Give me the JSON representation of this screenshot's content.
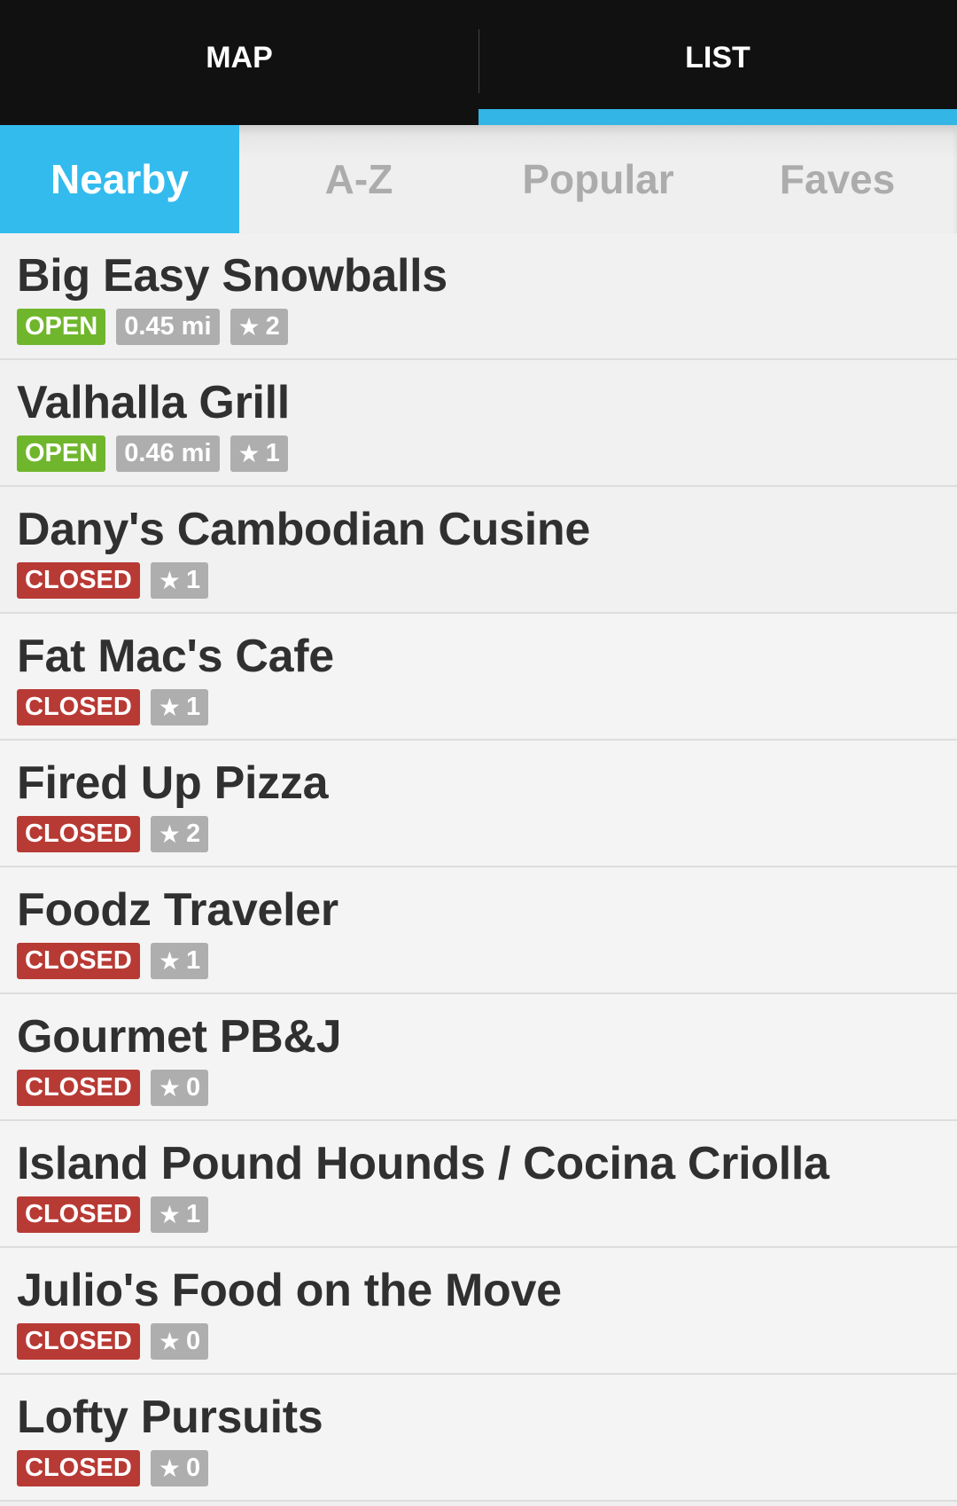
{
  "top_tabs": [
    {
      "label": "MAP",
      "active": false
    },
    {
      "label": "LIST",
      "active": true
    }
  ],
  "sub_tabs": [
    {
      "label": "Nearby",
      "active": true
    },
    {
      "label": "A-Z",
      "active": false
    },
    {
      "label": "Popular",
      "active": false
    },
    {
      "label": "Faves",
      "active": false
    }
  ],
  "colors": {
    "accent": "#33b5e5",
    "open": "#70b62c",
    "closed": "#b83a35",
    "badge_gray": "#aeaeae"
  },
  "icons": {
    "star": "star-icon"
  },
  "list": [
    {
      "name": "Big Easy Snowballs",
      "status": "OPEN",
      "distance": "0.45 mi",
      "faves": "2"
    },
    {
      "name": "Valhalla Grill",
      "status": "OPEN",
      "distance": "0.46 mi",
      "faves": "1"
    },
    {
      "name": "Dany's Cambodian Cusine",
      "status": "CLOSED",
      "distance": null,
      "faves": "1"
    },
    {
      "name": "Fat Mac's Cafe",
      "status": "CLOSED",
      "distance": null,
      "faves": "1"
    },
    {
      "name": "Fired Up Pizza",
      "status": "CLOSED",
      "distance": null,
      "faves": "2"
    },
    {
      "name": "Foodz Traveler",
      "status": "CLOSED",
      "distance": null,
      "faves": "1"
    },
    {
      "name": "Gourmet PB&J",
      "status": "CLOSED",
      "distance": null,
      "faves": "0"
    },
    {
      "name": "Island Pound Hounds / Cocina Criolla",
      "status": "CLOSED",
      "distance": null,
      "faves": "1"
    },
    {
      "name": "Julio's Food on the Move",
      "status": "CLOSED",
      "distance": null,
      "faves": "0"
    },
    {
      "name": "Lofty Pursuits",
      "status": "CLOSED",
      "distance": null,
      "faves": "0"
    }
  ]
}
